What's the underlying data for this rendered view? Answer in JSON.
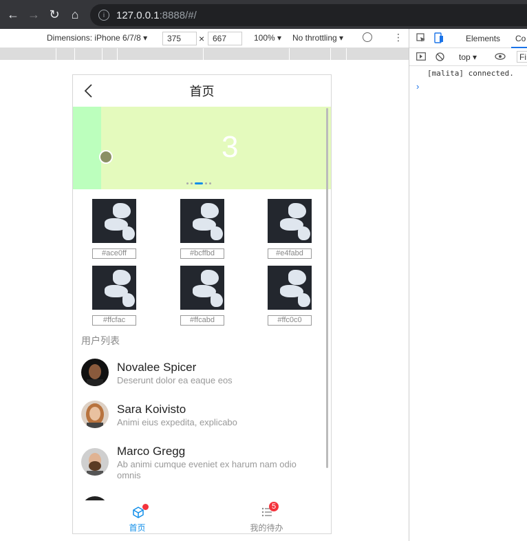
{
  "browser": {
    "url_host": "127.0.0.1",
    "url_rest": ":8888/#/"
  },
  "device_toolbar": {
    "dimensions_label": "Dimensions: iPhone 6/7/8 ▾",
    "width": "375",
    "height": "667",
    "zoom": "100% ▾",
    "throttling": "No throttling ▾"
  },
  "devtools": {
    "tabs": [
      "Elements",
      "Co"
    ],
    "context": "top ▾",
    "filter": "Fi",
    "console_log": "[malita] connected."
  },
  "app": {
    "page_title": "首页",
    "carousel": {
      "current_slide": "3",
      "colors": [
        "#ace0ff",
        "#bcffbd",
        "#e4fabd"
      ]
    },
    "grid": [
      {
        "label": "#ace0ff"
      },
      {
        "label": "#bcffbd"
      },
      {
        "label": "#e4fabd"
      },
      {
        "label": "#ffcfac"
      },
      {
        "label": "#ffcabd"
      },
      {
        "label": "#ffc0c0"
      }
    ],
    "section_title": "用户列表",
    "users": [
      {
        "name": "Novalee Spicer",
        "desc": "Deserunt dolor ea eaque eos"
      },
      {
        "name": "Sara Koivisto",
        "desc": "Animi eius expedita, explicabo"
      },
      {
        "name": "Marco Gregg",
        "desc": "Ab animi cumque eveniet ex harum nam odio omnis"
      }
    ],
    "tabs": [
      {
        "label": "首页",
        "color": "#108ee9"
      },
      {
        "label": "我的待办",
        "badge": "5",
        "color": "#888888"
      }
    ]
  }
}
